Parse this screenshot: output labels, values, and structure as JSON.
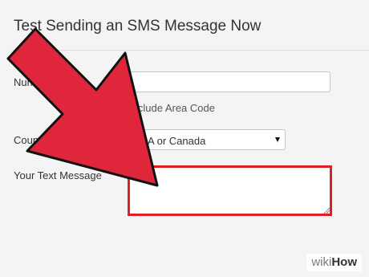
{
  "form": {
    "title": "Test Sending an SMS Message Now",
    "number_label": "Number",
    "number_value": "",
    "number_help": "Include Area Code",
    "country_label": "Country of Recipient",
    "country_selected": "USA or Canada",
    "message_label": "Your Text Message",
    "message_value": ""
  },
  "overlay": {
    "arrow_color": "#e0263b",
    "arrow_outline": "#111111",
    "highlight_color": "#e01e26"
  },
  "watermark": {
    "part_a": "wiki",
    "part_b": "How"
  }
}
